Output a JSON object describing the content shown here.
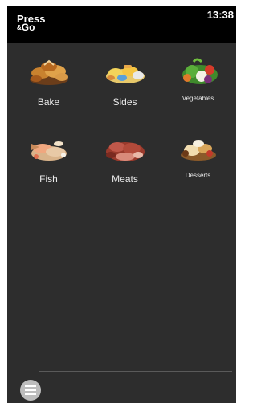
{
  "header": {
    "brand_line1": "Press",
    "brand_amp": "&",
    "brand_line2": "Go",
    "time": "13:38"
  },
  "categories": [
    {
      "label": "Bake",
      "icon": "bread-icon"
    },
    {
      "label": "Sides",
      "icon": "sides-icon"
    },
    {
      "label": "Vegetables",
      "icon": "vegetables-icon"
    },
    {
      "label": "Fish",
      "icon": "fish-icon"
    },
    {
      "label": "Meats",
      "icon": "meats-icon"
    },
    {
      "label": "Desserts",
      "icon": "desserts-icon"
    }
  ],
  "footer": {
    "menu_icon": "menu-icon"
  }
}
